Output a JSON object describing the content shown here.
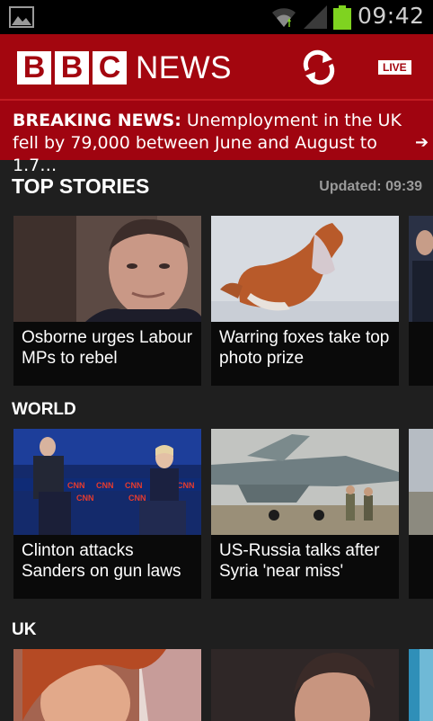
{
  "status_bar": {
    "time": "09:42",
    "icons": [
      "image-notification-icon",
      "wifi-icon",
      "signal-icon",
      "battery-icon"
    ],
    "battery_color": "#7fd320"
  },
  "header": {
    "logo_letters": [
      "B",
      "B",
      "C"
    ],
    "logo_word": "NEWS",
    "live_label": "LIVE",
    "brand_color": "#a3060f"
  },
  "breaking": {
    "prefix": "BREAKING NEWS:",
    "text": " Unemployment in the UK fell by 79,000 between June and August to 1.7…"
  },
  "top_stories": {
    "title": "TOP STORIES",
    "updated": "Updated: 09:39",
    "cards": [
      {
        "caption": "Osborne urges Labour MPs to rebel"
      },
      {
        "caption": "Warring foxes take top photo prize"
      }
    ]
  },
  "world": {
    "title": "WORLD",
    "cards": [
      {
        "caption": "Clinton attacks Sanders on gun laws"
      },
      {
        "caption": "US-Russia talks after Syria 'near miss'"
      }
    ]
  },
  "uk": {
    "title": "UK"
  },
  "debate_screen_text": [
    "CNN",
    "CNN",
    "CNN",
    "CNN",
    "CNN",
    "CNN"
  ]
}
